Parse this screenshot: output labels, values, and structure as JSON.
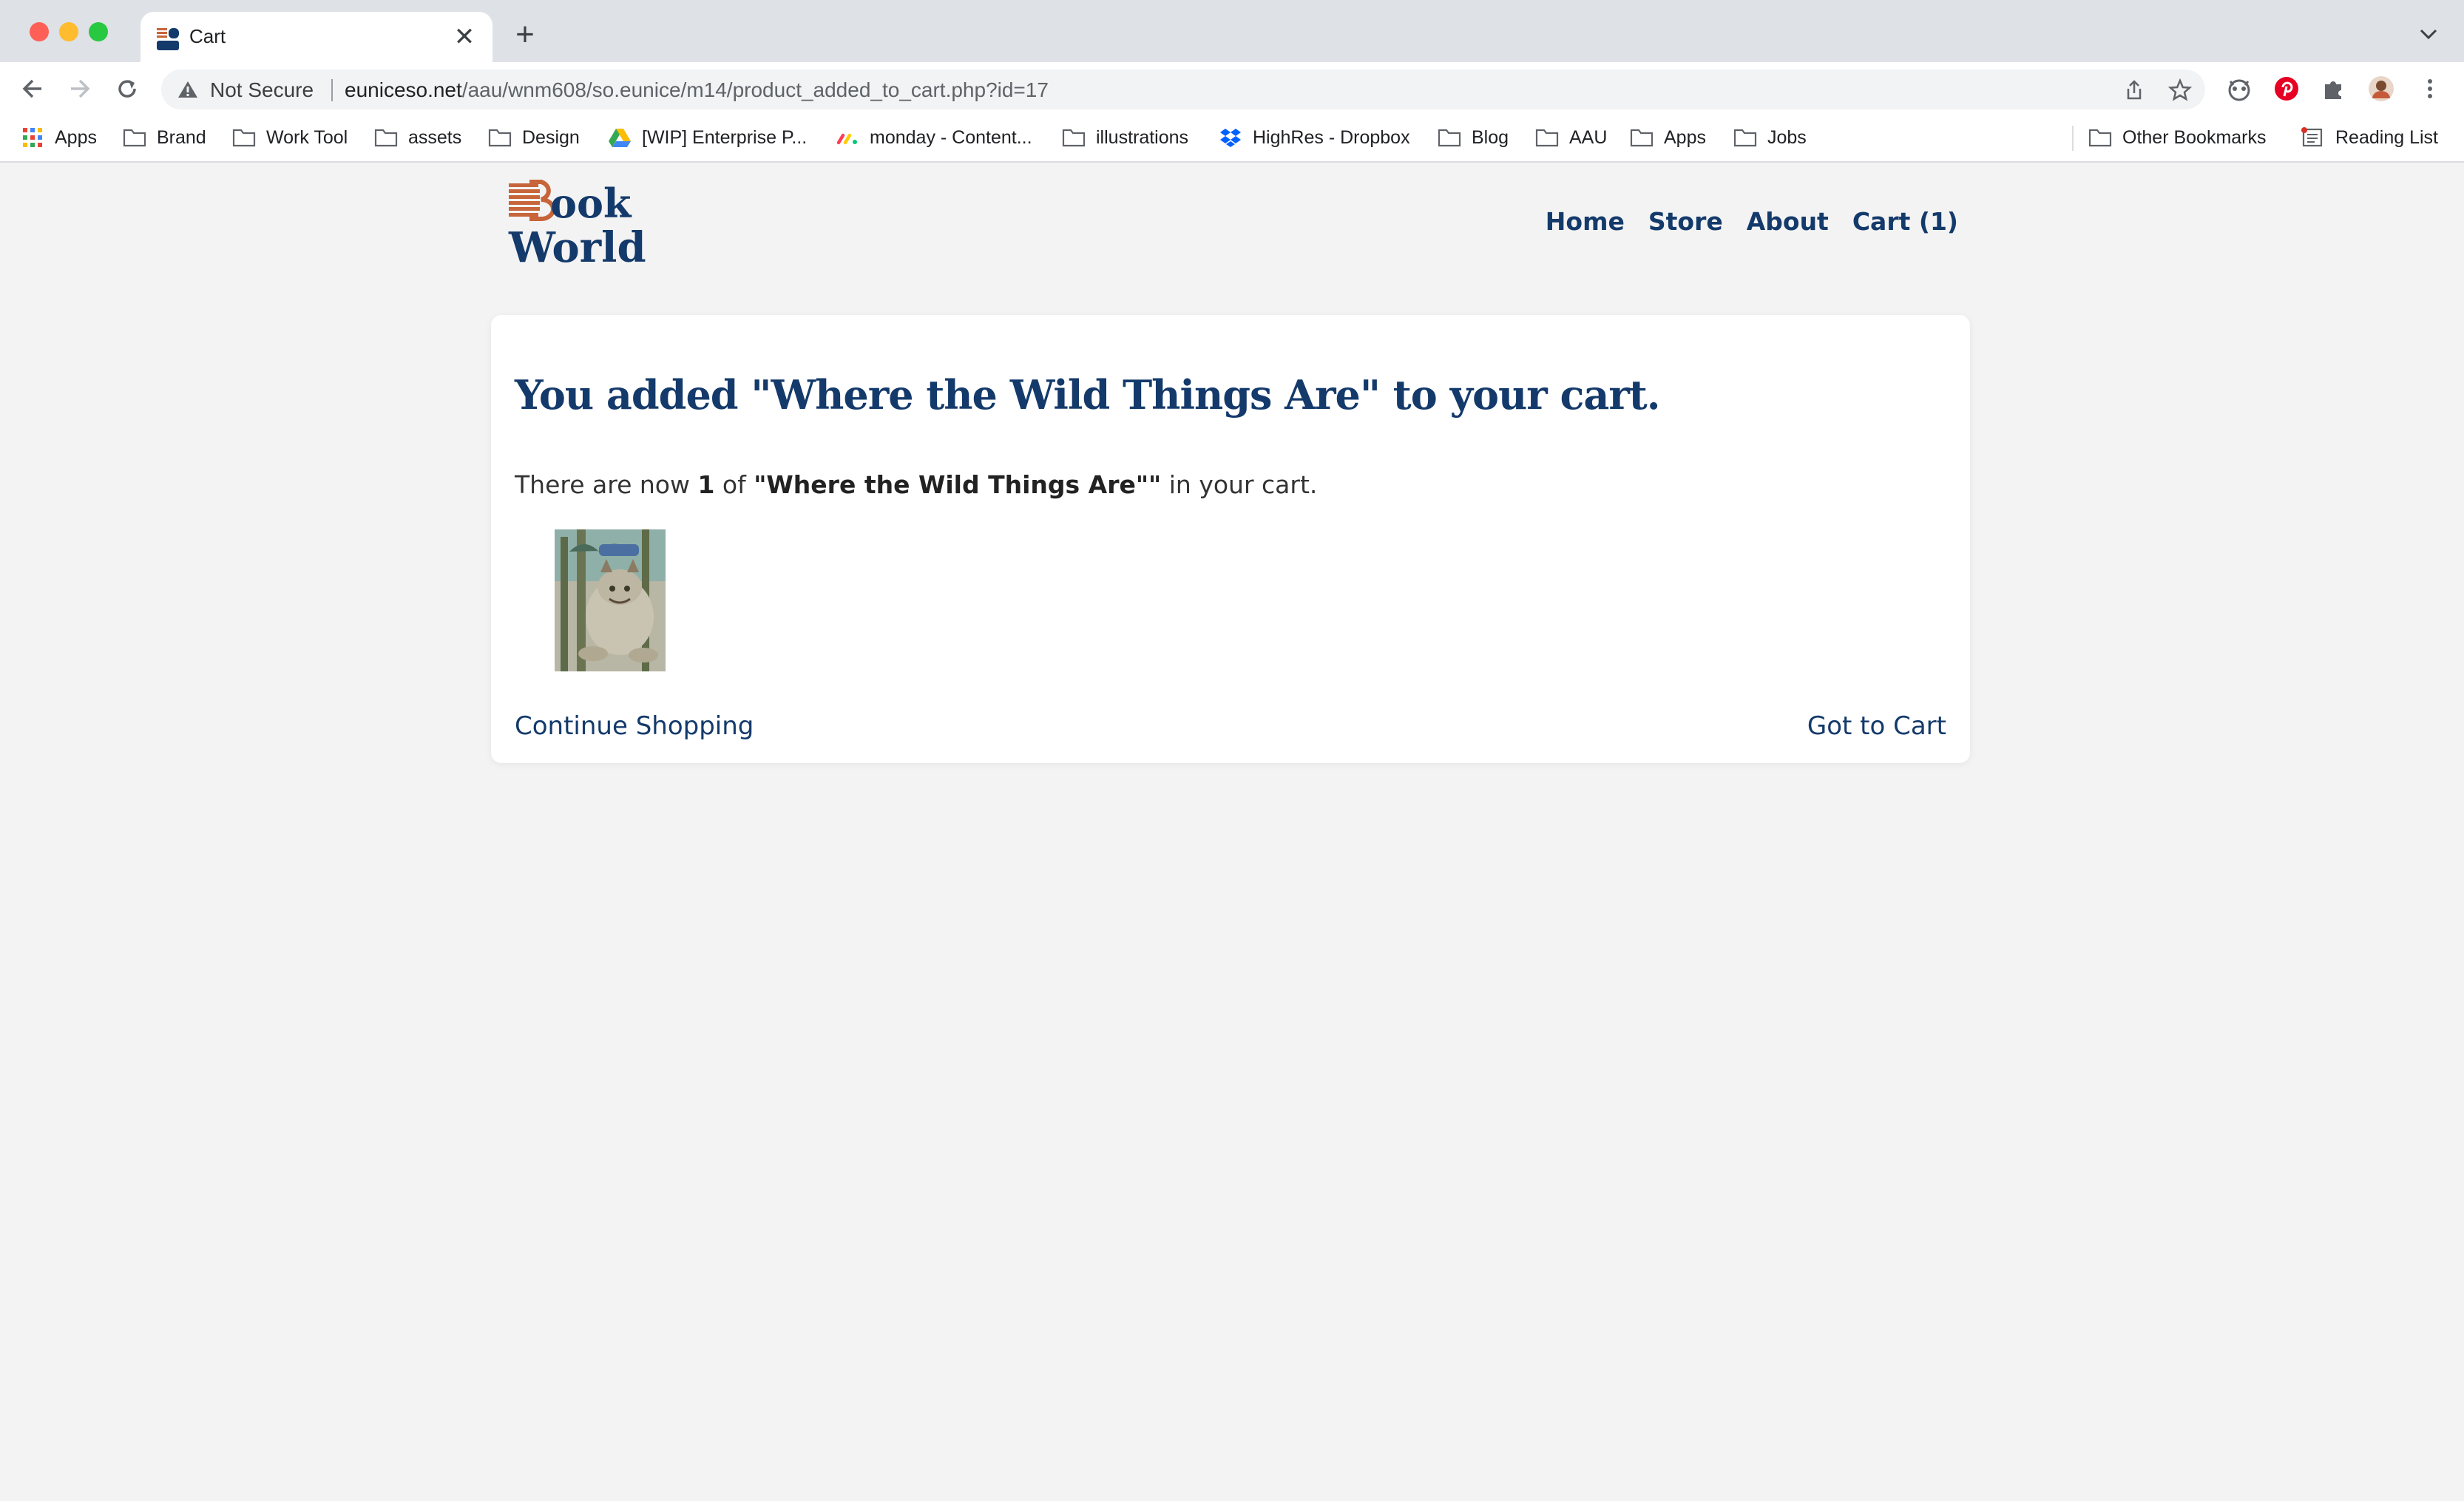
{
  "browser": {
    "tab_title": "Cart",
    "new_tab_symbol": "+",
    "close_symbol": "✕",
    "security_label": "Not Secure",
    "url_host": "euniceso.net",
    "url_path": "/aau/wnm608/so.eunice/m14/product_added_to_cart.php?id=17",
    "bookmarks": [
      {
        "label": "Apps",
        "icon": "apps-grid-icon"
      },
      {
        "label": "Brand",
        "icon": "folder-icon"
      },
      {
        "label": "Work Tool",
        "icon": "folder-icon"
      },
      {
        "label": "assets",
        "icon": "folder-icon"
      },
      {
        "label": "Design",
        "icon": "folder-icon"
      },
      {
        "label": "[WIP] Enterprise P...",
        "icon": "google-drive-icon"
      },
      {
        "label": "monday - Content...",
        "icon": "monday-icon"
      },
      {
        "label": "illustrations",
        "icon": "folder-icon"
      },
      {
        "label": "HighRes - Dropbox",
        "icon": "dropbox-icon"
      },
      {
        "label": "Blog",
        "icon": "folder-icon"
      },
      {
        "label": "AAU",
        "icon": "folder-icon"
      },
      {
        "label": "Apps",
        "icon": "folder-icon"
      },
      {
        "label": "Jobs",
        "icon": "folder-icon"
      }
    ],
    "other_bookmarks": "Other Bookmarks",
    "reading_list": "Reading List"
  },
  "site": {
    "logo_line1": "Book",
    "logo_line2": "World",
    "nav": {
      "home": "Home",
      "store": "Store",
      "about": "About",
      "cart": "Cart (1)"
    }
  },
  "confirmation": {
    "heading": "You added \"Where the Wild Things Are\" to your cart.",
    "text_prefix": "There are now ",
    "count": "1",
    "text_of": " of ",
    "product": "\"Where the Wild Things Are\"\"",
    "text_suffix": " in your cart.",
    "continue_label": "Continue Shopping",
    "cart_label": "Got to Cart"
  },
  "colors": {
    "brand_navy": "#143a6b",
    "logo_orange": "#c8643a",
    "page_bg": "#f3f3f3"
  }
}
